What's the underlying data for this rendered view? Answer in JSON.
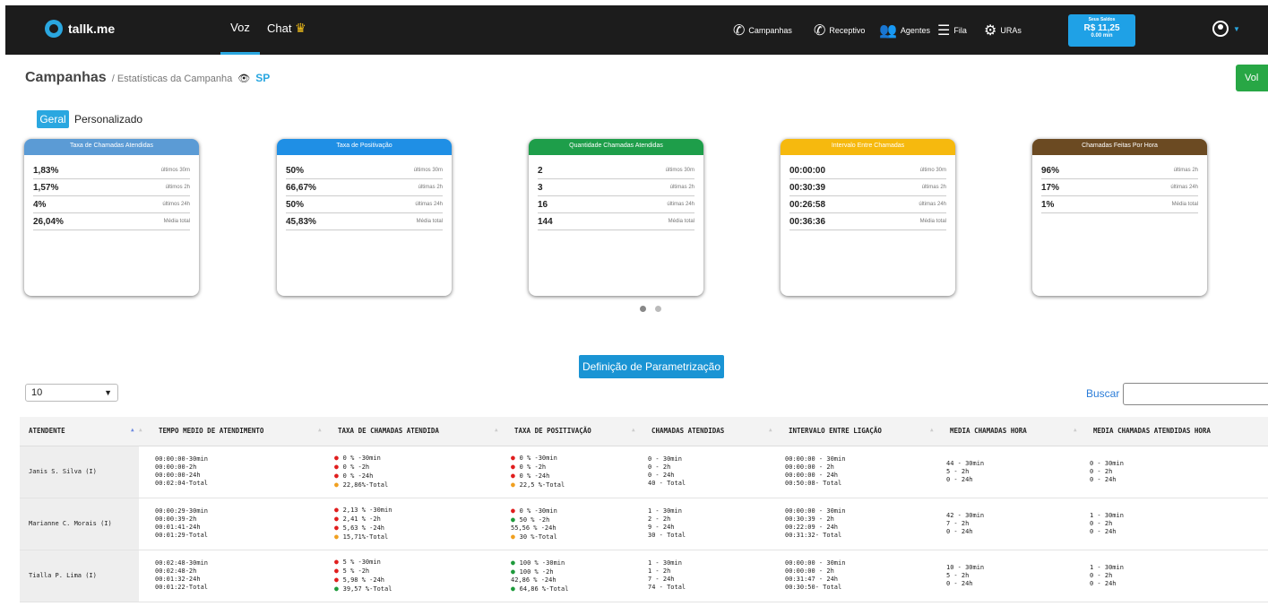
{
  "header": {
    "logo": "tallk.me",
    "tabs": [
      "Voz",
      "Chat"
    ],
    "nav": [
      {
        "label": "Campanhas",
        "icon": "phone-outgoing-icon"
      },
      {
        "label": "Receptivo",
        "icon": "phone-incoming-icon"
      },
      {
        "label": "Agentes",
        "icon": "users-icon"
      },
      {
        "label": "Fila",
        "icon": "queue-list-icon"
      },
      {
        "label": "URAs",
        "icon": "gear-icon"
      }
    ],
    "saldo": {
      "title": "Seus Saldos",
      "value": "R$ 11,25",
      "minutes": "0.00 min"
    }
  },
  "breadcrumb": {
    "title": "Campanhas",
    "sub": "/ Estatísticas da Campanha",
    "campaign": "SP"
  },
  "voltar": "Vol",
  "view_tabs": [
    "Geral",
    "Personalizado"
  ],
  "cards": [
    {
      "title": "Taxa de Chamadas Atendidas",
      "color": "#5b9bd5",
      "rows": [
        [
          "1,83%",
          "últimos 30m"
        ],
        [
          "1,57%",
          "últimos 2h"
        ],
        [
          "4%",
          "últimos 24h"
        ],
        [
          "26,04%",
          "Média total"
        ]
      ]
    },
    {
      "title": "Taxa de Positivação",
      "color": "#1f8fe5",
      "rows": [
        [
          "50%",
          "últimos 30m"
        ],
        [
          "66,67%",
          "últimas 2h"
        ],
        [
          "50%",
          "últimas 24h"
        ],
        [
          "45,83%",
          "Média total"
        ]
      ]
    },
    {
      "title": "Quantidade Chamadas Atendidas",
      "color": "#1e9e4a",
      "rows": [
        [
          "2",
          "últimos 30m"
        ],
        [
          "3",
          "últimas 2h"
        ],
        [
          "16",
          "últimas 24h"
        ],
        [
          "144",
          "Média total"
        ]
      ]
    },
    {
      "title": "Intervalo Entre Chamadas",
      "color": "#f6b90e",
      "rows": [
        [
          "00:00:00",
          "último 30m"
        ],
        [
          "00:30:39",
          "últimas 2h"
        ],
        [
          "00:26:58",
          "últimas 24h"
        ],
        [
          "00:36:36",
          "Média total"
        ]
      ]
    },
    {
      "title": "Chamadas Feitas Por Hora",
      "color": "#6b4a22",
      "rows": [
        [
          "96%",
          "últimas 2h"
        ],
        [
          "17%",
          "últimas 24h"
        ],
        [
          "1%",
          "Média total"
        ]
      ]
    }
  ],
  "param_button": "Definição de Parametrização",
  "page_size": "10",
  "search_label": "Buscar",
  "table": {
    "headers": [
      "ATENDENTE",
      "TEMPO MEDIO DE ATENDIMENTO",
      "TAXA DE CHAMADAS ATENDIDA",
      "TAXA DE POSITIVAÇÃO",
      "CHAMADAS ATENDIDAS",
      "INTERVALO ENTRE LIGAÇÃO",
      "MEDIA CHAMADAS HORA",
      "MEDIA CHAMADAS ATENDIDAS HORA"
    ],
    "rows": [
      {
        "name": "Janis S. Silva (I)",
        "tempo": [
          "00:00:00-30min",
          "00:00:00-2h",
          "00:00:00-24h",
          "00:02:04-Total"
        ],
        "taxa": [
          [
            "r",
            "0 % -30min"
          ],
          [
            "r",
            "0 % -2h"
          ],
          [
            "r",
            "0 % -24h"
          ],
          [
            "o",
            "22,86%-Total"
          ]
        ],
        "posit": [
          [
            "r",
            "0 % -30min"
          ],
          [
            "r",
            "0 % -2h"
          ],
          [
            "r",
            "0 % -24h"
          ],
          [
            "o",
            "22,5 %-Total"
          ]
        ],
        "atend": [
          "0 - 30min",
          "0 - 2h",
          "0 - 24h",
          "40 - Total"
        ],
        "interv": [
          "00:00:00 - 30min",
          "00:00:00 - 2h",
          "00:00:00 - 24h",
          "00:50:08- Total"
        ],
        "media": [
          "44 - 30min",
          "5 - 2h",
          "0 - 24h"
        ],
        "media_at": [
          "0 - 30min",
          "0 - 2h",
          "0 - 24h"
        ]
      },
      {
        "name": "Marianne C. Morais (I)",
        "tempo": [
          "00:00:29-30min",
          "00:00:39-2h",
          "00:01:41-24h",
          "00:01:29-Total"
        ],
        "taxa": [
          [
            "r",
            "2,13 % -30min"
          ],
          [
            "r",
            "2,41 % -2h"
          ],
          [
            "r",
            "5,63 % -24h"
          ],
          [
            "o",
            "15,71%-Total"
          ]
        ],
        "posit": [
          [
            "r",
            "0 % -30min"
          ],
          [
            "g",
            "50 % -2h"
          ],
          [
            "",
            "55,56 % -24h"
          ],
          [
            "o",
            "30 %-Total"
          ]
        ],
        "atend": [
          "1 - 30min",
          "2 - 2h",
          "9 - 24h",
          "30 - Total"
        ],
        "interv": [
          "00:00:00 - 30min",
          "00:30:39 - 2h",
          "00:22:09 - 24h",
          "00:31:32- Total"
        ],
        "media": [
          "42 - 30min",
          "7 - 2h",
          "0 - 24h"
        ],
        "media_at": [
          "1 - 30min",
          "0 - 2h",
          "0 - 24h"
        ]
      },
      {
        "name": "Tialla P. Lima (I)",
        "tempo": [
          "00:02:48-30min",
          "00:02:48-2h",
          "00:01:32-24h",
          "00:01:22-Total"
        ],
        "taxa": [
          [
            "r",
            "5 % -30min"
          ],
          [
            "r",
            "5 % -2h"
          ],
          [
            "r",
            "5,98 % -24h"
          ],
          [
            "g",
            "39,57 %-Total"
          ]
        ],
        "posit": [
          [
            "g",
            "100 % -30min"
          ],
          [
            "g",
            "100 % -2h"
          ],
          [
            "",
            "42,86 % -24h"
          ],
          [
            "g",
            "64,86 %-Total"
          ]
        ],
        "atend": [
          "1 - 30min",
          "1 - 2h",
          "7 - 24h",
          "74 - Total"
        ],
        "interv": [
          "00:00:00 - 30min",
          "00:00:00 - 2h",
          "00:31:47 - 24h",
          "00:30:50- Total"
        ],
        "media": [
          "10 - 30min",
          "5 - 2h",
          "0 - 24h"
        ],
        "media_at": [
          "1 - 30min",
          "0 - 2h",
          "0 - 24h"
        ]
      }
    ]
  }
}
